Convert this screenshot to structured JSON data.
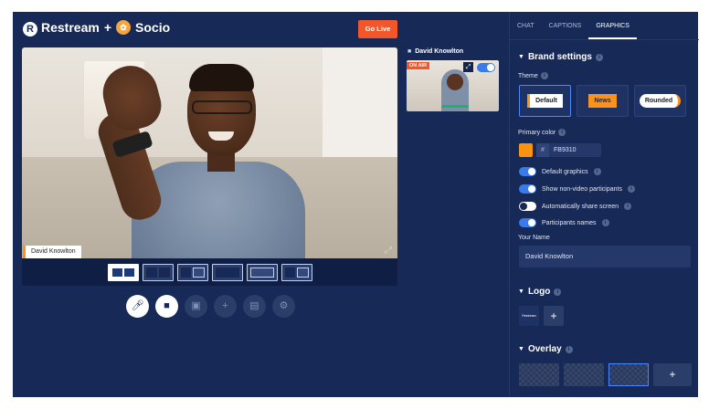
{
  "header": {
    "logo_letter": "R",
    "brand_primary": "Restream",
    "brand_join": "+",
    "brand_secondary": "Socio",
    "go_live_label": "Go Live"
  },
  "stage": {
    "participant_name": "David Knowlton",
    "layout_options": [
      "layout-1",
      "layout-2",
      "layout-3",
      "layout-4",
      "layout-5",
      "layout-6"
    ],
    "active_layout_index": 0
  },
  "controls": [
    "microphone-icon",
    "camera-icon",
    "screen-share-icon",
    "invite-guest-icon",
    "media-icon",
    "settings-icon"
  ],
  "preview": {
    "name": "David Knowlton",
    "on_air_label": "ON AIR"
  },
  "panel": {
    "tabs": [
      "CHAT",
      "CAPTIONS",
      "GRAPHICS"
    ],
    "active_tab": "GRAPHICS",
    "brand_settings_title": "Brand settings",
    "theme_label": "Theme",
    "themes": [
      "Default",
      "News",
      "Rounded"
    ],
    "selected_theme": "Default",
    "primary_color_label": "Primary color",
    "primary_color": "#FB9310",
    "primary_color_hex": "FB9310",
    "toggles": [
      {
        "label": "Default graphics",
        "on": true
      },
      {
        "label": "Show non-video participants",
        "on": true
      },
      {
        "label": "Automatically share screen",
        "on": false
      },
      {
        "label": "Participants names",
        "on": true
      }
    ],
    "your_name_label": "Your Name",
    "your_name_value": "David Knowlton",
    "logo_title": "Logo",
    "logo_thumb_text": "Restream",
    "overlay_title": "Overlay"
  },
  "colors": {
    "background": "#172a57",
    "accent_orange": "#f1572a",
    "toggle_blue": "#3a7bec"
  }
}
